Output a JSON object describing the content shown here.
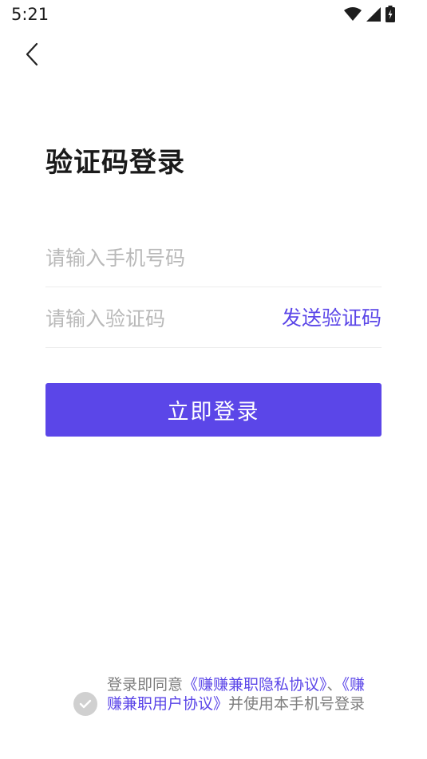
{
  "status_bar": {
    "time": "5:21",
    "icons": [
      "wifi-icon",
      "signal-icon",
      "battery-icon"
    ]
  },
  "nav": {
    "back_icon": "back-arrow-icon"
  },
  "title": "验证码登录",
  "phone": {
    "placeholder": "请输入手机号码",
    "value": ""
  },
  "code": {
    "placeholder": "请输入验证码",
    "value": "",
    "send_label": "发送验证码"
  },
  "login_button": "立即登录",
  "agreement": {
    "prefix": "登录即同意",
    "privacy_link": "《赚赚兼职隐私协议》",
    "separator": "、",
    "user_link": "《赚赚兼职用户协议》",
    "suffix": "并使用本手机号登录"
  },
  "colors": {
    "accent": "#5b46e8",
    "placeholder": "#b9b9b9",
    "divider": "#ececec",
    "check_bg": "#d0d0d0"
  }
}
